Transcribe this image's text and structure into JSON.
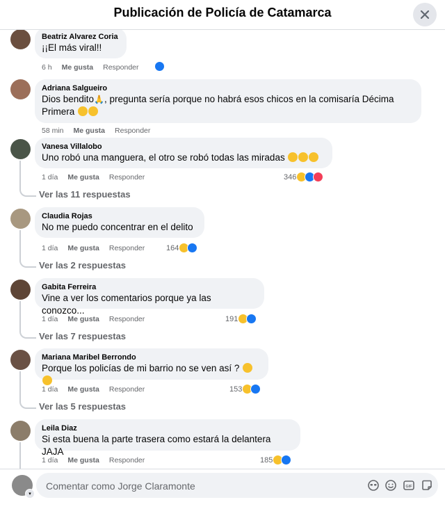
{
  "header": {
    "title": "Publicación de Policía de Catamarca"
  },
  "icons": {
    "close": "close-icon",
    "like": "like-reaction-icon",
    "haha": "haha-reaction-icon",
    "love": "love-reaction-icon"
  },
  "colors": {
    "like": "#1877f2",
    "haha": "#f7c12c",
    "love": "#f33e58",
    "muted": "#65676b",
    "bubble": "#f0f2f5"
  },
  "comments": [
    {
      "author": "Beatriz Alvarez Coria",
      "text": "¡¡El más viral!!",
      "time": "6 h",
      "like": "Me gusta",
      "reply": "Responder",
      "count": ""
    },
    {
      "author": "Adriana Salgueiro",
      "text1": "Dios bendito",
      "text2": ", pregunta sería porque no habrá esos chicos en la comisaría Décima",
      "text3": "Primera",
      "time": "58 min",
      "like": "Me gusta",
      "reply": "Responder",
      "count": ""
    },
    {
      "author": "Vanesa Villalobo",
      "text": "Uno robó una manguera, el otro se robó todas las miradas",
      "time": "1 día",
      "like": "Me gusta",
      "reply": "Responder",
      "count": "346",
      "replies": "Ver las 11 respuestas"
    },
    {
      "author": "Claudia Rojas",
      "text": "No me puedo concentrar en el delito",
      "time": "1 día",
      "like": "Me gusta",
      "reply": "Responder",
      "count": "164",
      "replies": "Ver las 2 respuestas"
    },
    {
      "author": "Gabita Ferreira",
      "text": "Vine a ver los comentarios porque ya las conozco...",
      "time": "1 día",
      "like": "Me gusta",
      "reply": "Responder",
      "count": "191",
      "replies": "Ver las 7 respuestas"
    },
    {
      "author": "Mariana Maribel Berrondo",
      "text": "Porque los policías de mi barrio no se ven así ?",
      "time": "1 día",
      "like": "Me gusta",
      "reply": "Responder",
      "count": "153",
      "replies": "Ver las 5 respuestas"
    },
    {
      "author": "Leila Diaz",
      "text": "Si esta buena la parte trasera como estará la delantera JAJA",
      "time": "1 día",
      "like": "Me gusta",
      "reply": "Responder",
      "count": "185"
    }
  ],
  "composer": {
    "placeholder": "Comentar como Jorge Claramonte",
    "tools": [
      "avatar-sticker-icon",
      "emoji-icon",
      "gif-icon",
      "sticker-icon"
    ]
  }
}
